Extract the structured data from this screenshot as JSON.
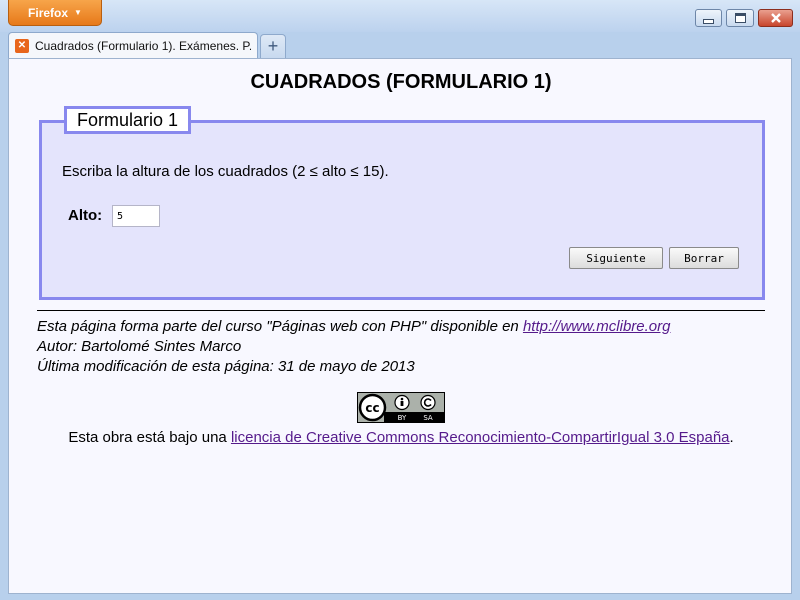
{
  "browser": {
    "menu_label": "Firefox",
    "tab_title": "Cuadrados (Formulario 1). Exámenes. P...",
    "new_tab_label": "+"
  },
  "page": {
    "title": "CUADRADOS (FORMULARIO 1)",
    "legend": "Formulario 1",
    "instruction": "Escriba la altura de los cuadrados (2 ≤ alto ≤ 15).",
    "alto_label": "Alto:",
    "alto_value": "5",
    "submit_label": "Siguiente",
    "reset_label": "Borrar"
  },
  "footer": {
    "line1_prefix": "Esta página forma parte del curso \"Páginas web con PHP\" disponible en ",
    "line1_link": "http://www.mclibre.org",
    "line2": "Autor: Bartolomé Sintes Marco",
    "line3": "Última modificación de esta página: 31 de mayo de 2013"
  },
  "license": {
    "badge_labels": [
      "cc",
      "BY",
      "SA"
    ],
    "prefix": "Esta obra está bajo una ",
    "link": "licencia de Creative Commons Reconocimiento-CompartirIgual 3.0 España",
    "suffix": "."
  },
  "colors": {
    "fieldset_border": "#8888ee",
    "fieldset_bg": "#e4e4fc",
    "page_bg": "#f8f8ff",
    "link": "#551a8b",
    "firefox_button": "#e7791a"
  }
}
